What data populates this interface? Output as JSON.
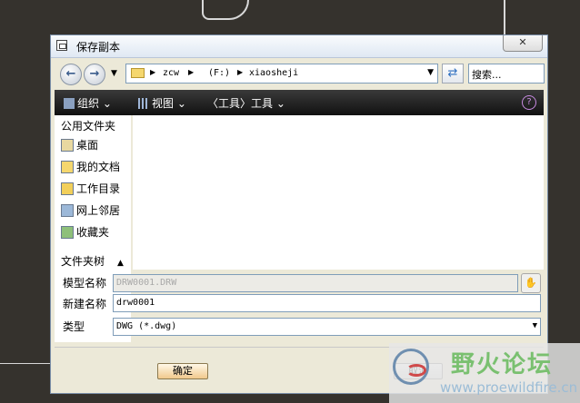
{
  "window": {
    "title": "保存副本",
    "close_label": "✕"
  },
  "nav": {
    "back_icon": "back-arrow-icon",
    "forward_icon": "forward-arrow-icon",
    "address": {
      "segments": [
        "zcw",
        "(F:)",
        "xiaosheji"
      ]
    },
    "search_placeholder": "搜索..."
  },
  "toolbar": {
    "organize": "组织",
    "views": "视图",
    "tools": "〈工具〉工具"
  },
  "sidebar": {
    "header": "公用文件夹",
    "items": [
      {
        "label": "桌面",
        "icon": "desktop-icon"
      },
      {
        "label": "我的文档",
        "icon": "documents-icon"
      },
      {
        "label": "工作目录",
        "icon": "work-dir-icon"
      },
      {
        "label": "网上邻居",
        "icon": "network-icon"
      },
      {
        "label": "收藏夹",
        "icon": "favorites-icon"
      }
    ]
  },
  "folder_tree": {
    "label": "文件夹树"
  },
  "form": {
    "model_name_label": "模型名称",
    "model_name_value": "DRW0001.DRW",
    "new_name_label": "新建名称",
    "new_name_value": "drw0001",
    "type_label": "类型",
    "type_value": "DWG (*.dwg)"
  },
  "buttons": {
    "ok": "确定",
    "cancel": "取消"
  },
  "watermark": {
    "title": "野火论坛",
    "url": "www.proewildfire.cn"
  },
  "colors": {
    "toolbar_bg": "#1c1c1c",
    "dialog_bg": "#ece9d8",
    "accent_green": "#7ac070"
  }
}
